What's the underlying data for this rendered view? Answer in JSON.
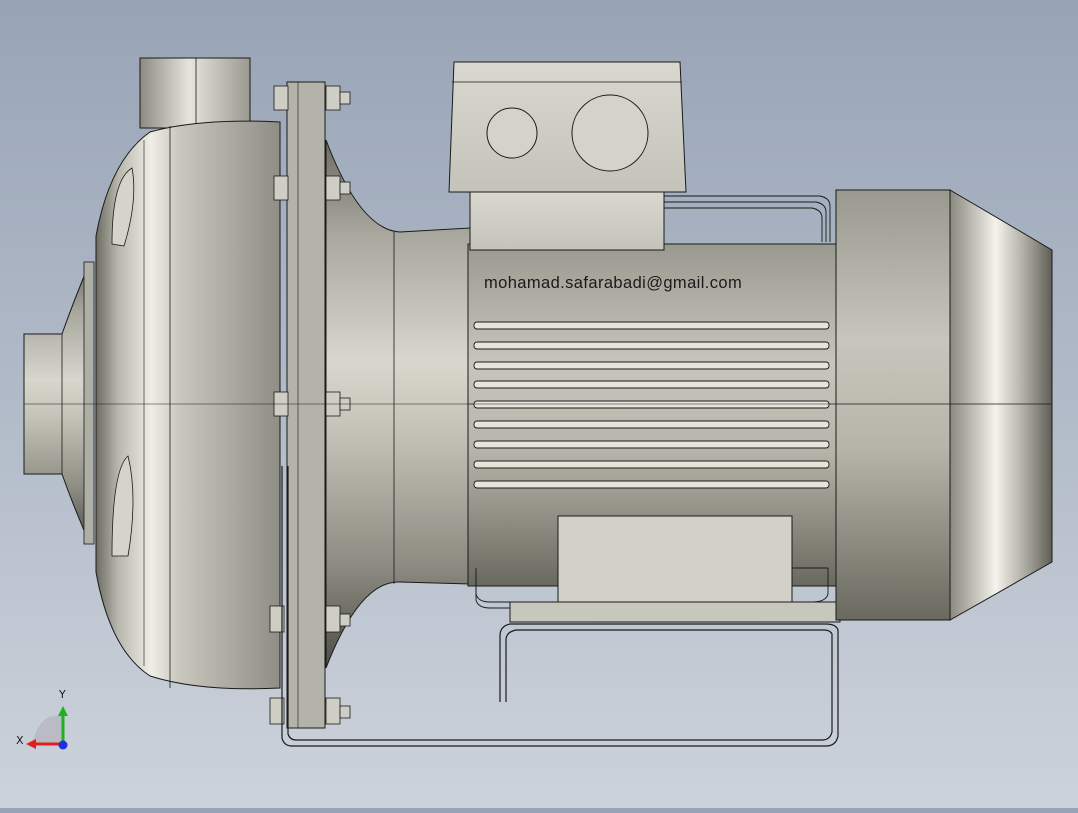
{
  "viewport": {
    "background_top": "#98a4b6",
    "background_bottom": "#cdd3dc",
    "model_color": "#c9c8bd",
    "edge_color": "#1a1a1a"
  },
  "model": {
    "engraving_text": "mohamad.safarabadi@gmail.com"
  },
  "triad": {
    "x_label": "X",
    "y_label": "Y",
    "x_color": "#e02020",
    "y_color": "#20b020",
    "z_color": "#2030e0"
  }
}
